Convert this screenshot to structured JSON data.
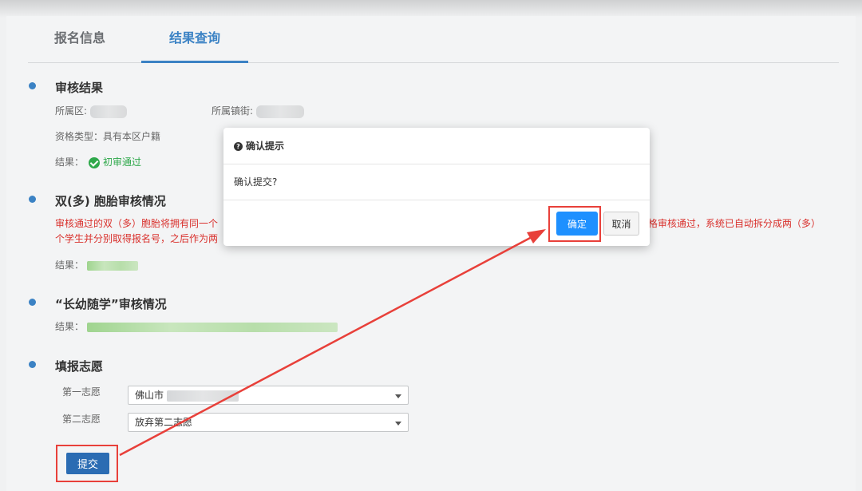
{
  "tabs": [
    {
      "label": "报名信息"
    },
    {
      "label": "结果查询"
    }
  ],
  "audit": {
    "title": "审核结果",
    "district_label": "所属区:",
    "town_label": "所属镇街:",
    "qualification": "资格类型：具有本区户籍",
    "result_label": "结果：",
    "result_value": "初审通过"
  },
  "twins": {
    "title": "双(多) 胞胎审核情况",
    "notice_line1_left": "审核通过的双（多）胞胎将拥有同一个",
    "notice_line1_right": "资格审核通过，系统已自动拆分成两（多）",
    "notice_line2_left": "个学生并分别取得报名号，之后作为两",
    "result_label": "结果："
  },
  "siblings": {
    "title": "“长幼随学”审核情况",
    "result_label": "结果："
  },
  "wishes": {
    "title": "填报志愿",
    "first_label": "第一志愿",
    "first_value": "佛山市",
    "second_label": "第二志愿",
    "second_value": "放弃第二志愿",
    "submit_label": "提交"
  },
  "modal": {
    "title": "确认提示",
    "message": "确认提交?",
    "ok_label": "确定",
    "cancel_label": "取消"
  },
  "colors": {
    "accent": "#3b82c4",
    "ok_button": "#1e90ff",
    "highlight": "#e8403a",
    "success": "#2ea84a"
  }
}
